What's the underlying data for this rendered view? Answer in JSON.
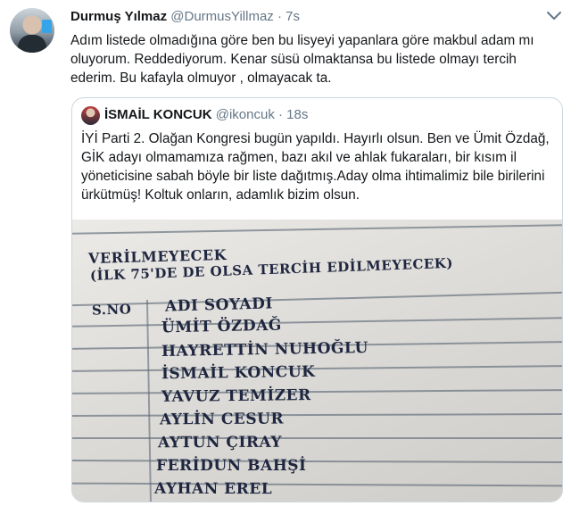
{
  "tweet": {
    "author_name": "Durmuş Yılmaz",
    "author_handle": "@DurmusYillmaz",
    "separator": "·",
    "time": "7s",
    "text": "Adım listede olmadığına göre ben bu lisyeyi yapanlara göre makbul adam mı oluyorum. Reddediyorum. Kenar süsü olmaktansa bu listede olmayı tercih ederim. Bu kafayla olmuyor , olmayacak ta."
  },
  "quoted": {
    "author_name": "İSMAİL KONCUK",
    "author_handle": "@ikoncuk",
    "separator": "·",
    "time": "18s",
    "text": "İYİ Parti 2. Olağan Kongresi bugün yapıldı. Hayırlı olsun. Ben ve Ümit Özdağ, GİK adayı olmamamıza rağmen, bazı akıl ve ahlak fukaraları, bir kısım il yöneticisine sabah böyle bir liste dağıtmış.Aday olma ihtimalimiz bile birilerini ürkütmüş! Koltuk onların, adamlık bizim olsun."
  },
  "photo": {
    "heading1": "VERİLMEYECEK",
    "heading2": "(İLK 75'DE DE OLSA TERCİH EDİLMEYECEK)",
    "col_sno": "S.NO",
    "col_name": "ADI SOYADI",
    "names": [
      "ÜMİT ÖZDAĞ",
      "HAYRETTİN NUHOĞLU",
      "İSMAİL KONCUK",
      "YAVUZ TEMİZER",
      "AYLİN CESUR",
      "AYTUN ÇIRAY",
      "FERİDUN BAHŞİ",
      "AYHAN EREL"
    ]
  }
}
